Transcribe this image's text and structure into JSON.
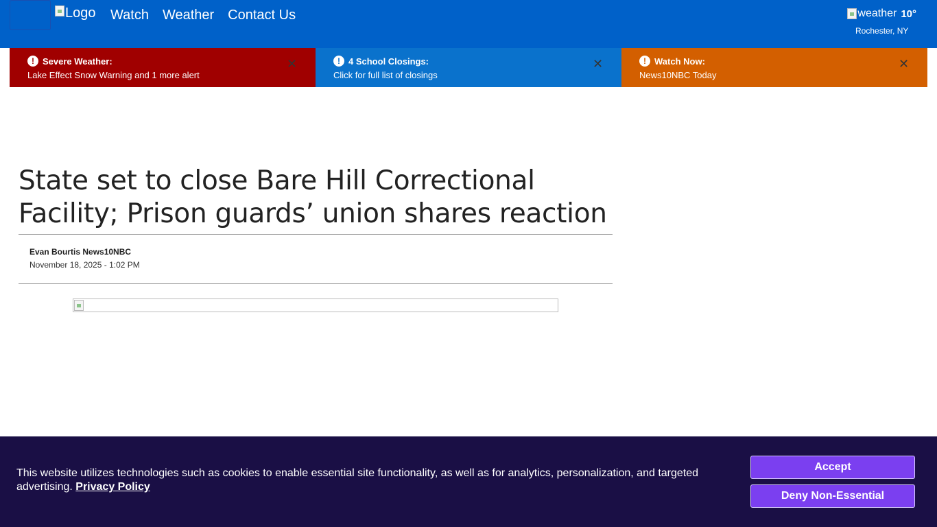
{
  "header": {
    "logo_alt": "Logo",
    "nav": [
      "Watch",
      "Weather",
      "Contact Us"
    ],
    "weather": {
      "icon_alt": "weather",
      "temp": "10°",
      "location": "Rochester, NY"
    },
    "bg_color": "#0061c9"
  },
  "alerts": [
    {
      "title": "Severe Weather:",
      "text": "Lake Effect Snow Warning and 1 more alert",
      "color": "#a00000"
    },
    {
      "title": "4 School Closings:",
      "text": "Click for full list of closings",
      "color": "#0a72cc"
    },
    {
      "title": "Watch Now:",
      "text": "News10NBC Today",
      "color": "#d35f00"
    }
  ],
  "article": {
    "headline": "State set to close Bare Hill Correctional Facility; Prison guards’ union shares reaction",
    "author": "Evan Bourtis News10NBC",
    "date": "November 18, 2025 - 1:02 PM"
  },
  "cookie_banner": {
    "text": "This website utilizes technologies such as cookies to enable essential site functionality, as well as for analytics, personalization, and targeted advertising.",
    "policy_link": "Privacy Policy",
    "accept": "Accept",
    "deny": "Deny Non-Essential",
    "bg_color": "#1a0f45",
    "button_color": "#7b3ff0"
  }
}
